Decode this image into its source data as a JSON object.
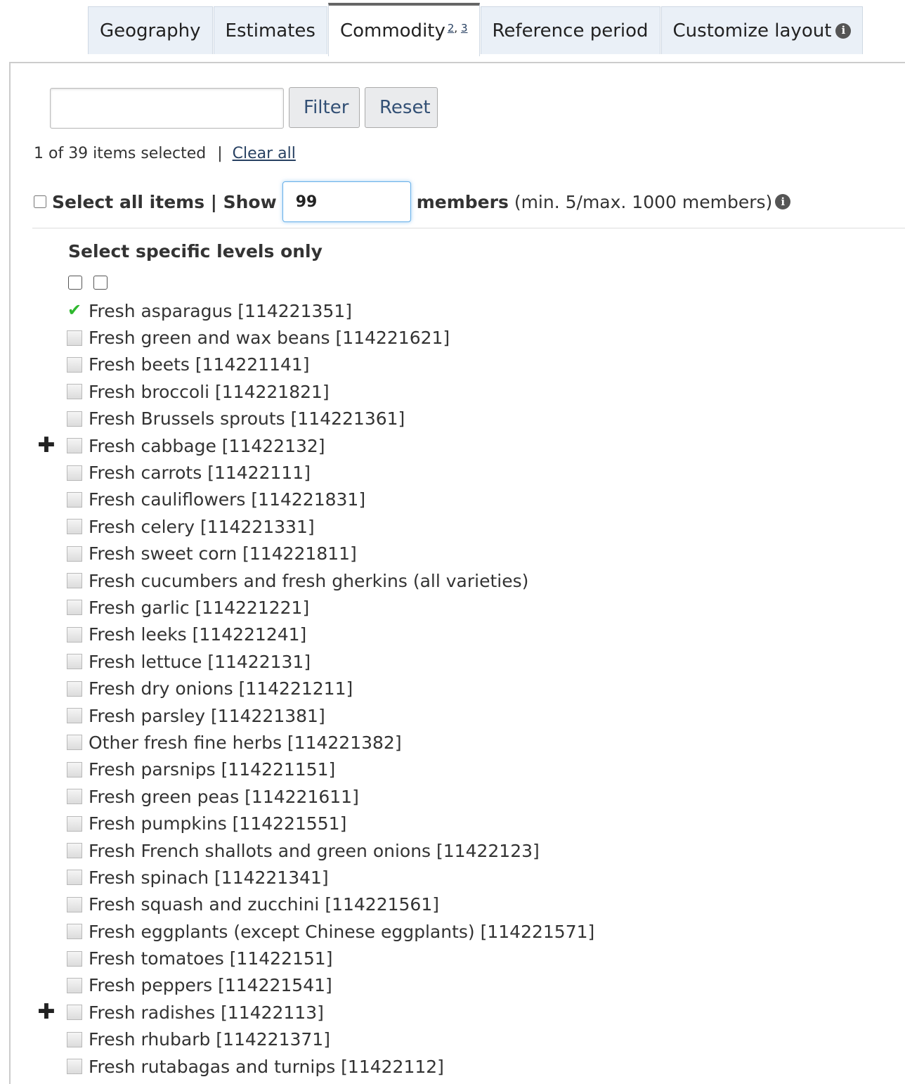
{
  "tabs": [
    {
      "label": "Geography"
    },
    {
      "label": "Estimates"
    },
    {
      "label": "Commodity",
      "notes": [
        "2",
        "3"
      ]
    },
    {
      "label": "Reference period"
    },
    {
      "label": "Customize layout"
    }
  ],
  "filter": {
    "input_value": "",
    "filter_label": "Filter",
    "reset_label": "Reset"
  },
  "selection": {
    "status": "1 of 39 items selected",
    "separator": "|",
    "clear_all": "Clear all"
  },
  "show": {
    "select_all": "Select all items | Show",
    "value": "99",
    "members": "members",
    "range": "(min. 5/max. 1000 members)"
  },
  "levels_title": "Select specific levels only",
  "items": [
    {
      "label": "Fresh asparagus [114221351]",
      "checked": true,
      "expandable": false
    },
    {
      "label": "Fresh green and wax beans [114221621]",
      "checked": false,
      "expandable": false
    },
    {
      "label": "Fresh beets [114221141]",
      "checked": false,
      "expandable": false
    },
    {
      "label": "Fresh broccoli [114221821]",
      "checked": false,
      "expandable": false
    },
    {
      "label": "Fresh Brussels sprouts [114221361]",
      "checked": false,
      "expandable": false
    },
    {
      "label": "Fresh cabbage [11422132]",
      "checked": false,
      "expandable": true
    },
    {
      "label": "Fresh carrots [11422111]",
      "checked": false,
      "expandable": false
    },
    {
      "label": "Fresh cauliflowers [114221831]",
      "checked": false,
      "expandable": false
    },
    {
      "label": "Fresh celery [114221331]",
      "checked": false,
      "expandable": false
    },
    {
      "label": "Fresh sweet corn [114221811]",
      "checked": false,
      "expandable": false
    },
    {
      "label": "Fresh cucumbers and fresh gherkins (all varieties)",
      "checked": false,
      "expandable": false
    },
    {
      "label": "Fresh garlic [114221221]",
      "checked": false,
      "expandable": false
    },
    {
      "label": "Fresh leeks [114221241]",
      "checked": false,
      "expandable": false
    },
    {
      "label": "Fresh lettuce [11422131]",
      "checked": false,
      "expandable": false
    },
    {
      "label": "Fresh dry onions [114221211]",
      "checked": false,
      "expandable": false
    },
    {
      "label": "Fresh parsley [114221381]",
      "checked": false,
      "expandable": false
    },
    {
      "label": "Other fresh fine herbs [114221382]",
      "checked": false,
      "expandable": false
    },
    {
      "label": "Fresh parsnips [114221151]",
      "checked": false,
      "expandable": false
    },
    {
      "label": "Fresh green peas [114221611]",
      "checked": false,
      "expandable": false
    },
    {
      "label": "Fresh pumpkins [114221551]",
      "checked": false,
      "expandable": false
    },
    {
      "label": "Fresh French shallots and green onions [11422123]",
      "checked": false,
      "expandable": false
    },
    {
      "label": "Fresh spinach [114221341]",
      "checked": false,
      "expandable": false
    },
    {
      "label": "Fresh squash and zucchini [114221561]",
      "checked": false,
      "expandable": false
    },
    {
      "label": "Fresh eggplants (except Chinese eggplants) [114221571]",
      "checked": false,
      "expandable": false
    },
    {
      "label": "Fresh tomatoes [11422151]",
      "checked": false,
      "expandable": false
    },
    {
      "label": "Fresh peppers [114221541]",
      "checked": false,
      "expandable": false
    },
    {
      "label": "Fresh radishes [11422113]",
      "checked": false,
      "expandable": true
    },
    {
      "label": "Fresh rhubarb [114221371]",
      "checked": false,
      "expandable": false
    },
    {
      "label": "Fresh rutabagas and turnips [11422112]",
      "checked": false,
      "expandable": false
    }
  ],
  "icons": {
    "info": "info-icon",
    "expand": "plus-icon",
    "check": "checkmark-icon"
  },
  "colors": {
    "tab_bg": "#eaf0f7",
    "link": "#284162",
    "check": "#2eb82e",
    "focus": "#66afe9"
  }
}
